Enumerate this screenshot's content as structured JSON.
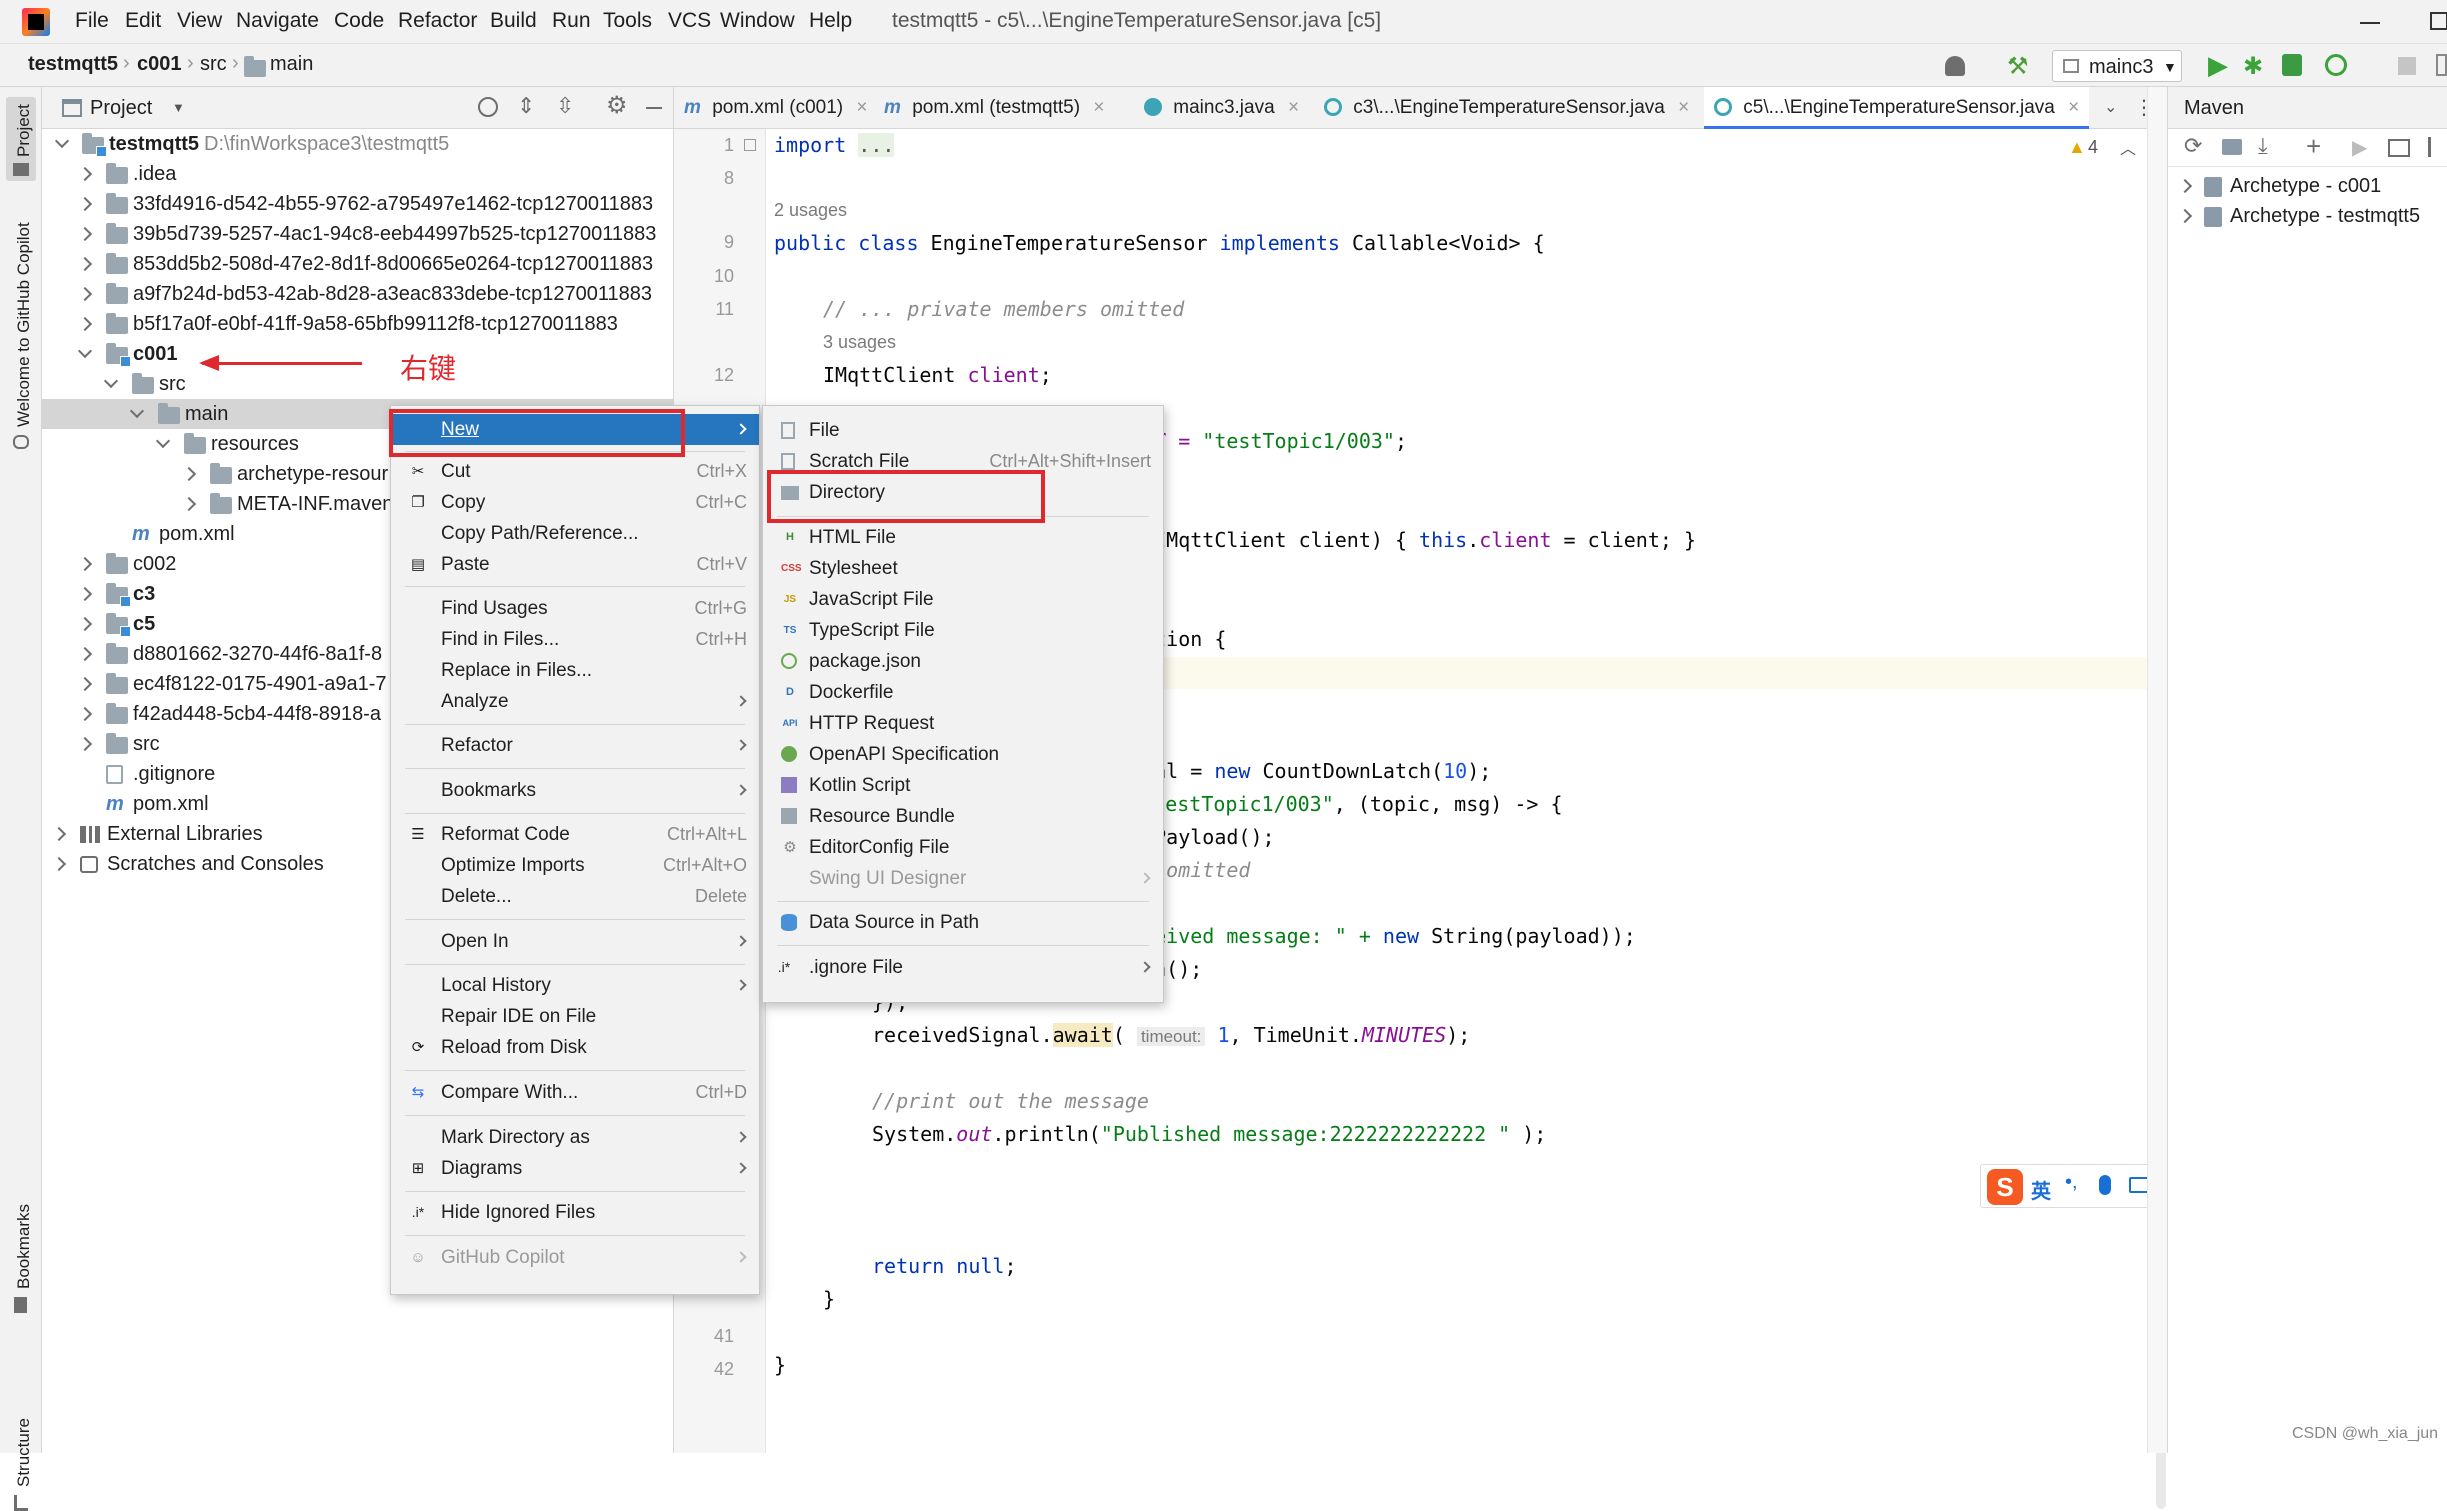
{
  "menubar": {
    "items": [
      "File",
      "Edit",
      "View",
      "Navigate",
      "Code",
      "Refactor",
      "Build",
      "Run",
      "Tools",
      "VCS",
      "Window",
      "Help"
    ],
    "title": "testmqtt5 - c5\\...\\EngineTemperatureSensor.java [c5]"
  },
  "breadcrumb": {
    "items": [
      "testmqtt5",
      "c001",
      "src",
      "main"
    ]
  },
  "toolbar": {
    "run_config": "mainc3"
  },
  "sidebar": {
    "project_tab": "Project",
    "copilot_tab": "Welcome to GitHub Copilot",
    "bookmarks_tab": "Bookmarks",
    "structure_tab": "Structure"
  },
  "project": {
    "header": "Project",
    "root_name": "testmqtt5",
    "root_path": "D:\\finWorkspace3\\testmqtt5",
    "rows": [
      ".idea",
      "33fd4916-d542-4b55-9762-a795497e1462-tcp1270011883",
      "39b5d739-5257-4ac1-94c8-eeb44997b525-tcp1270011883",
      "853dd5b2-508d-47e2-8d1f-8d00665e0264-tcp1270011883",
      "a9f7b24d-bd53-42ab-8d28-a3eac833debe-tcp1270011883",
      "b5f17a0f-e0bf-41ff-9a58-65bfb99112f8-tcp1270011883",
      "c001",
      "src",
      "main",
      "resources",
      "archetype-resour",
      "META-INF.maven",
      "pom.xml",
      "c002",
      "c3",
      "c5",
      "d8801662-3270-44f6-8a1f-8",
      "ec4f8122-0175-4901-a9a1-7",
      "f42ad448-5cb4-44f8-8918-a",
      "src",
      ".gitignore",
      "pom.xml",
      "External Libraries",
      "Scratches and Consoles"
    ]
  },
  "annotation": {
    "text": "右键"
  },
  "tabs": [
    "pom.xml (c001)",
    "pom.xml (testmqtt5)",
    "mainc3.java",
    "c3\\...\\EngineTemperatureSensor.java",
    "c5\\...\\EngineTemperatureSensor.java"
  ],
  "editor": {
    "warnings": "4",
    "line_numbers": [
      "1",
      "8",
      "9",
      "10",
      "11",
      "12",
      "41",
      "42"
    ],
    "lines": {
      "l1a": "import",
      "l1b": "...",
      "usages2": "2 usages",
      "l2a": "public class ",
      "l2b": "EngineTemperatureSensor ",
      "l2c": "implements ",
      "l2d": "Callable<Void> {",
      "l3": "// ... private members omitted",
      "usages3": "3 usages",
      "l4a": "IMqttClient ",
      "l4b": "client",
      "l4c": ";",
      "l5a": "OPIC = ",
      "l5b": "\"testTopic1/003\"",
      "l5c": ";",
      "l6a": "or(IMqttClient client) { ",
      "l6b": "this",
      "l6c": ".",
      "l6d": "client",
      "l6e": " = client; }",
      "l7": "ception {",
      "l8": ")) {",
      "l9a": "ignal = ",
      "l9b": "new ",
      "l9c": "CountDownLatch(",
      "l9d": "10",
      "l9e": ");",
      "l10a": "r: ",
      "l10b": "\"testTopic1/003\"",
      "l10c": ", (topic, msg) -> {",
      "l11": "getPayload();",
      "l12": "ing omitted",
      "l13": "age",
      "l14a": "Received message: \" + ",
      "l14b": "new ",
      "l14c": "String(payload));",
      "l15": "Down();",
      "l16": "});",
      "l17a": "receivedSignal.",
      "l17b": "await",
      "l17c": "( ",
      "l17d": "timeout:",
      "l17e": "1",
      "l17f": ", TimeUnit.",
      "l17g": "MINUTES",
      "l17h": ");",
      "l18": "//print out the message",
      "l19a": "System.",
      "l19b": "out",
      "l19c": ".println(",
      "l19d": "\"Published message:2222222222222 \"",
      "l19e": " );",
      "l20a": "return ",
      "l20b": "null",
      "l20c": ";",
      "l21": "}",
      "l22": "}"
    }
  },
  "maven": {
    "header": "Maven",
    "items": [
      "Archetype - c001",
      "Archetype - testmqtt5"
    ]
  },
  "context_menu": {
    "items": [
      {
        "label": "New",
        "shortcut": ""
      },
      {
        "label": "Cut",
        "shortcut": "Ctrl+X"
      },
      {
        "label": "Copy",
        "shortcut": "Ctrl+C"
      },
      {
        "label": "Copy Path/Reference...",
        "shortcut": ""
      },
      {
        "label": "Paste",
        "shortcut": "Ctrl+V"
      },
      {
        "label": "Find Usages",
        "shortcut": "Ctrl+G"
      },
      {
        "label": "Find in Files...",
        "shortcut": "Ctrl+H"
      },
      {
        "label": "Replace in Files...",
        "shortcut": ""
      },
      {
        "label": "Analyze",
        "shortcut": ""
      },
      {
        "label": "Refactor",
        "shortcut": ""
      },
      {
        "label": "Bookmarks",
        "shortcut": ""
      },
      {
        "label": "Reformat Code",
        "shortcut": "Ctrl+Alt+L"
      },
      {
        "label": "Optimize Imports",
        "shortcut": "Ctrl+Alt+O"
      },
      {
        "label": "Delete...",
        "shortcut": "Delete"
      },
      {
        "label": "Open In",
        "shortcut": ""
      },
      {
        "label": "Local History",
        "shortcut": ""
      },
      {
        "label": "Repair IDE on File",
        "shortcut": ""
      },
      {
        "label": "Reload from Disk",
        "shortcut": ""
      },
      {
        "label": "Compare With...",
        "shortcut": "Ctrl+D"
      },
      {
        "label": "Mark Directory as",
        "shortcut": ""
      },
      {
        "label": "Diagrams",
        "shortcut": ""
      },
      {
        "label": "Hide Ignored Files",
        "shortcut": ""
      },
      {
        "label": "GitHub Copilot",
        "shortcut": ""
      }
    ]
  },
  "submenu": {
    "items": [
      {
        "label": "File",
        "shortcut": ""
      },
      {
        "label": "Scratch File",
        "shortcut": "Ctrl+Alt+Shift+Insert"
      },
      {
        "label": "Directory",
        "shortcut": ""
      },
      {
        "label": "HTML File",
        "shortcut": ""
      },
      {
        "label": "Stylesheet",
        "shortcut": ""
      },
      {
        "label": "JavaScript File",
        "shortcut": ""
      },
      {
        "label": "TypeScript File",
        "shortcut": ""
      },
      {
        "label": "package.json",
        "shortcut": ""
      },
      {
        "label": "Dockerfile",
        "shortcut": ""
      },
      {
        "label": "HTTP Request",
        "shortcut": ""
      },
      {
        "label": "OpenAPI Specification",
        "shortcut": ""
      },
      {
        "label": "Kotlin Script",
        "shortcut": ""
      },
      {
        "label": "Resource Bundle",
        "shortcut": ""
      },
      {
        "label": "EditorConfig File",
        "shortcut": ""
      },
      {
        "label": "Swing UI Designer",
        "shortcut": ""
      },
      {
        "label": "Data Source in Path",
        "shortcut": ""
      },
      {
        "label": ".ignore File",
        "shortcut": ""
      }
    ]
  },
  "ime": {
    "label": "英"
  },
  "watermark": "CSDN @wh_xia_jun"
}
